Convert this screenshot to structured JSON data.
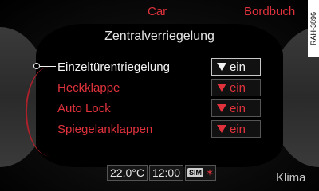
{
  "corners": {
    "top_center": "Car",
    "top_right": "Bordbuch",
    "bottom_right": "Klima"
  },
  "side_tag": "RAH-3896",
  "title": "Zentralverriegelung",
  "items": [
    {
      "label": "Einzeltürentriegelung",
      "value": "ein",
      "selected": true
    },
    {
      "label": "Heckklappe",
      "value": "ein",
      "selected": false
    },
    {
      "label": "Auto Lock",
      "value": "ein",
      "selected": false
    },
    {
      "label": "Spiegelanklappen",
      "value": "ein",
      "selected": false
    }
  ],
  "status": {
    "temperature": "22.0°C",
    "time": "12:00",
    "sim": "SIM",
    "bluetooth_icon": "bluetooth-icon"
  },
  "colors": {
    "accent_red": "#e0323c",
    "selected_white": "#f2f2f2"
  }
}
